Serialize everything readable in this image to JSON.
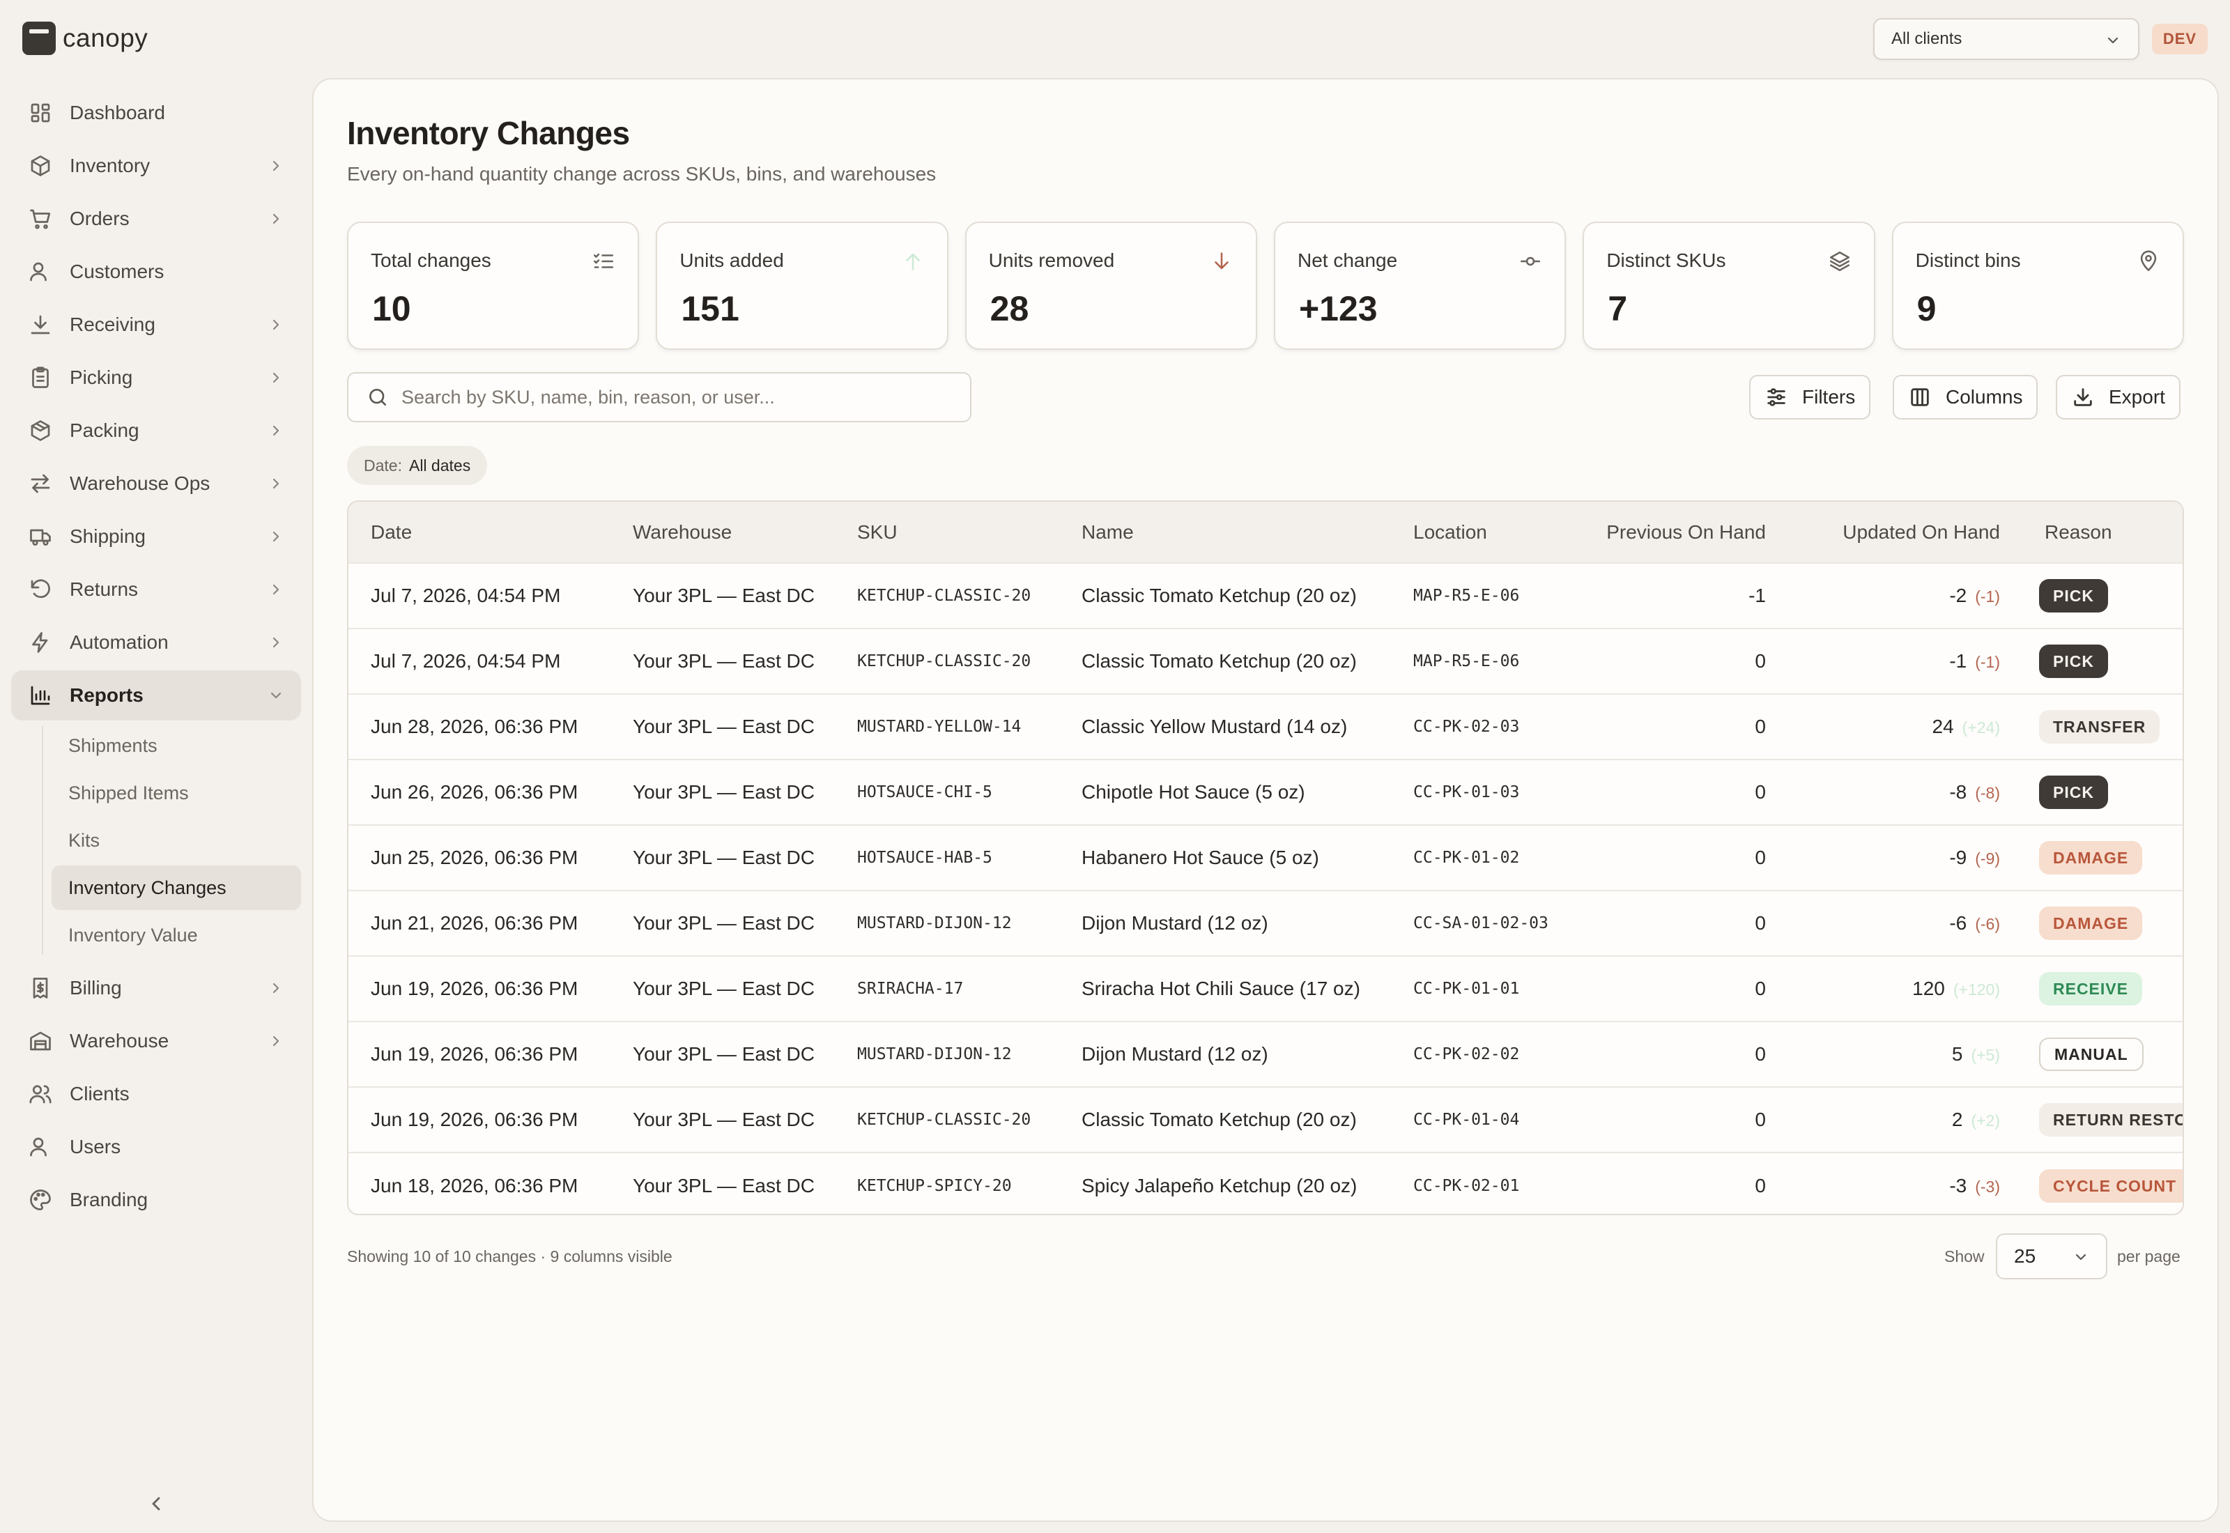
{
  "app": {
    "name": "canopy",
    "env_badge": "DEV"
  },
  "client_select": {
    "value": "All clients"
  },
  "sidebar": {
    "items": [
      {
        "label": "Dashboard",
        "icon": "dashboard-icon",
        "has_children": false
      },
      {
        "label": "Inventory",
        "icon": "box-icon",
        "has_children": true
      },
      {
        "label": "Orders",
        "icon": "cart-icon",
        "has_children": true
      },
      {
        "label": "Customers",
        "icon": "user-icon",
        "has_children": false
      },
      {
        "label": "Receiving",
        "icon": "download-icon",
        "has_children": true
      },
      {
        "label": "Picking",
        "icon": "clipboard-icon",
        "has_children": true
      },
      {
        "label": "Packing",
        "icon": "package-icon",
        "has_children": true
      },
      {
        "label": "Warehouse Ops",
        "icon": "arrows-icon",
        "has_children": true
      },
      {
        "label": "Shipping",
        "icon": "truck-icon",
        "has_children": true
      },
      {
        "label": "Returns",
        "icon": "undo-icon",
        "has_children": true
      },
      {
        "label": "Automation",
        "icon": "bolt-icon",
        "has_children": true
      },
      {
        "label": "Reports",
        "icon": "bar-chart-icon",
        "has_children": true,
        "expanded": true,
        "active": true
      },
      {
        "label": "Billing",
        "icon": "receipt-icon",
        "has_children": true
      },
      {
        "label": "Warehouse",
        "icon": "warehouse-icon",
        "has_children": true
      },
      {
        "label": "Clients",
        "icon": "users-icon",
        "has_children": false
      },
      {
        "label": "Users",
        "icon": "user-icon",
        "has_children": false
      },
      {
        "label": "Branding",
        "icon": "palette-icon",
        "has_children": false
      }
    ],
    "reports_children": [
      {
        "label": "Shipments"
      },
      {
        "label": "Shipped Items"
      },
      {
        "label": "Kits"
      },
      {
        "label": "Inventory Changes",
        "active": true
      },
      {
        "label": "Inventory Value"
      }
    ]
  },
  "page": {
    "title": "Inventory Changes",
    "subtitle": "Every on-hand quantity change across SKUs, bins, and warehouses"
  },
  "stats": [
    {
      "label": "Total changes",
      "value": "10",
      "icon": "checklist-icon",
      "icon_color": "#6a645e"
    },
    {
      "label": "Units added",
      "value": "151",
      "icon": "arrow-up-icon",
      "icon_color": "#cde9d5"
    },
    {
      "label": "Units removed",
      "value": "28",
      "icon": "arrow-down-icon",
      "icon_color": "#b3644f"
    },
    {
      "label": "Net change",
      "value": "+123",
      "icon": "commit-icon",
      "icon_color": "#6a645e"
    },
    {
      "label": "Distinct SKUs",
      "value": "7",
      "icon": "layers-icon",
      "icon_color": "#6a645e"
    },
    {
      "label": "Distinct bins",
      "value": "9",
      "icon": "map-pin-icon",
      "icon_color": "#6a645e"
    }
  ],
  "search": {
    "placeholder": "Search by SKU, name, bin, reason, or user..."
  },
  "toolbar": {
    "filters_label": "Filters",
    "columns_label": "Columns",
    "export_label": "Export"
  },
  "date_filter": {
    "key": "Date:",
    "value": "All dates"
  },
  "table": {
    "columns": [
      "Date",
      "Warehouse",
      "SKU",
      "Name",
      "Location",
      "Previous On Hand",
      "Updated On Hand",
      "Reason"
    ],
    "rows": [
      {
        "date": "Jul 7, 2026, 04:54 PM",
        "warehouse": "Your 3PL — East DC",
        "sku": "KETCHUP-CLASSIC-20",
        "name": "Classic Tomato Ketchup (20 oz)",
        "location": "MAP-R5-E-06",
        "prev": "-1",
        "updated": "-2",
        "delta": "(-1)",
        "delta_sign": "neg",
        "reason": "PICK",
        "reason_style": "dark"
      },
      {
        "date": "Jul 7, 2026, 04:54 PM",
        "warehouse": "Your 3PL — East DC",
        "sku": "KETCHUP-CLASSIC-20",
        "name": "Classic Tomato Ketchup (20 oz)",
        "location": "MAP-R5-E-06",
        "prev": "0",
        "updated": "-1",
        "delta": "(-1)",
        "delta_sign": "neg",
        "reason": "PICK",
        "reason_style": "dark"
      },
      {
        "date": "Jun 28, 2026, 06:36 PM",
        "warehouse": "Your 3PL — East DC",
        "sku": "MUSTARD-YELLOW-14",
        "name": "Classic Yellow Mustard (14 oz)",
        "location": "CC-PK-02-03",
        "prev": "0",
        "updated": "24",
        "delta": "(+24)",
        "delta_sign": "pos",
        "reason": "TRANSFER",
        "reason_style": "light"
      },
      {
        "date": "Jun 26, 2026, 06:36 PM",
        "warehouse": "Your 3PL — East DC",
        "sku": "HOTSAUCE-CHI-5",
        "name": "Chipotle Hot Sauce (5 oz)",
        "location": "CC-PK-01-03",
        "prev": "0",
        "updated": "-8",
        "delta": "(-8)",
        "delta_sign": "neg",
        "reason": "PICK",
        "reason_style": "dark"
      },
      {
        "date": "Jun 25, 2026, 06:36 PM",
        "warehouse": "Your 3PL — East DC",
        "sku": "HOTSAUCE-HAB-5",
        "name": "Habanero Hot Sauce (5 oz)",
        "location": "CC-PK-01-02",
        "prev": "0",
        "updated": "-9",
        "delta": "(-9)",
        "delta_sign": "neg",
        "reason": "DAMAGE",
        "reason_style": "peach"
      },
      {
        "date": "Jun 21, 2026, 06:36 PM",
        "warehouse": "Your 3PL — East DC",
        "sku": "MUSTARD-DIJON-12",
        "name": "Dijon Mustard (12 oz)",
        "location": "CC-SA-01-02-03",
        "prev": "0",
        "updated": "-6",
        "delta": "(-6)",
        "delta_sign": "neg",
        "reason": "DAMAGE",
        "reason_style": "peach"
      },
      {
        "date": "Jun 19, 2026, 06:36 PM",
        "warehouse": "Your 3PL — East DC",
        "sku": "SRIRACHA-17",
        "name": "Sriracha Hot Chili Sauce (17 oz)",
        "location": "CC-PK-01-01",
        "prev": "0",
        "updated": "120",
        "delta": "(+120)",
        "delta_sign": "pos",
        "reason": "RECEIVE",
        "reason_style": "green"
      },
      {
        "date": "Jun 19, 2026, 06:36 PM",
        "warehouse": "Your 3PL — East DC",
        "sku": "MUSTARD-DIJON-12",
        "name": "Dijon Mustard (12 oz)",
        "location": "CC-PK-02-02",
        "prev": "0",
        "updated": "5",
        "delta": "(+5)",
        "delta_sign": "pos",
        "reason": "MANUAL",
        "reason_style": "outline"
      },
      {
        "date": "Jun 19, 2026, 06:36 PM",
        "warehouse": "Your 3PL — East DC",
        "sku": "KETCHUP-CLASSIC-20",
        "name": "Classic Tomato Ketchup (20 oz)",
        "location": "CC-PK-01-04",
        "prev": "0",
        "updated": "2",
        "delta": "(+2)",
        "delta_sign": "pos",
        "reason": "RETURN RESTOCK",
        "reason_style": "light"
      },
      {
        "date": "Jun 18, 2026, 06:36 PM",
        "warehouse": "Your 3PL — East DC",
        "sku": "KETCHUP-SPICY-20",
        "name": "Spicy Jalapeño Ketchup (20 oz)",
        "location": "CC-PK-02-01",
        "prev": "0",
        "updated": "-3",
        "delta": "(-3)",
        "delta_sign": "neg",
        "reason": "CYCLE COUNT",
        "reason_style": "peach"
      }
    ]
  },
  "footer": {
    "summary": "Showing 10 of 10 changes · 9 columns visible",
    "show_label": "Show",
    "page_size": "25",
    "per_page_label": "per page"
  }
}
